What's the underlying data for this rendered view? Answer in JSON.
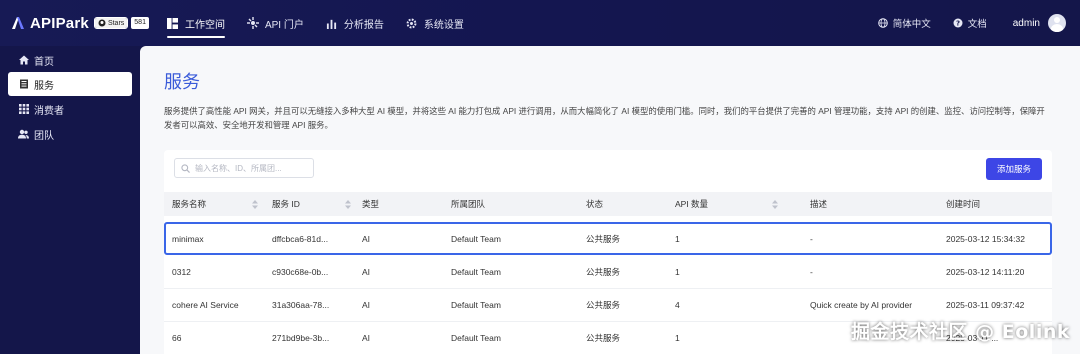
{
  "app": {
    "name": "APIPark",
    "badge_label": "Stars",
    "badge_count": "581"
  },
  "nav": [
    {
      "label": "工作空间",
      "icon": "workspace-icon"
    },
    {
      "label": "API 门户",
      "icon": "portal-icon"
    },
    {
      "label": "分析报告",
      "icon": "chart-icon"
    },
    {
      "label": "系统设置",
      "icon": "gear-icon"
    }
  ],
  "topright": {
    "language": "简体中文",
    "docs": "文档",
    "user": "admin"
  },
  "sidebar": [
    {
      "label": "首页",
      "icon": "home-icon"
    },
    {
      "label": "服务",
      "icon": "service-icon"
    },
    {
      "label": "消费者",
      "icon": "grid-icon"
    },
    {
      "label": "团队",
      "icon": "team-icon"
    }
  ],
  "page": {
    "title": "服务",
    "description": "服务提供了高性能 API 网关，并且可以无缝接入多种大型 AI 模型，并将这些 AI 能力打包成 API 进行调用，从而大幅简化了 AI 模型的使用门槛。同时，我们的平台提供了完善的 API 管理功能，支持 API 的创建、监控、访问控制等，保障开发者可以高效、安全地开发和管理 API 服务。"
  },
  "search": {
    "placeholder": "输入名称、ID、所属团..."
  },
  "add_button": "添加服务",
  "table": {
    "columns": [
      "服务名称",
      "服务 ID",
      "类型",
      "所属团队",
      "状态",
      "API 数量",
      "描述",
      "创建时间"
    ],
    "rows": [
      {
        "name": "minimax",
        "id": "dffcbca6-81d...",
        "type": "AI",
        "team": "Default Team",
        "status": "公共服务",
        "api_count": "1",
        "desc": "-",
        "created": "2025-03-12 15:34:32"
      },
      {
        "name": "0312",
        "id": "c930c68e-0b...",
        "type": "AI",
        "team": "Default Team",
        "status": "公共服务",
        "api_count": "1",
        "desc": "-",
        "created": "2025-03-12 14:11:20"
      },
      {
        "name": "cohere AI Service",
        "id": "31a306aa-78...",
        "type": "AI",
        "team": "Default Team",
        "status": "公共服务",
        "api_count": "4",
        "desc": "Quick create by AI provider",
        "created": "2025-03-11 09:37:42"
      },
      {
        "name": "66",
        "id": "271bd9be-3b...",
        "type": "AI",
        "team": "Default Team",
        "status": "公共服务",
        "api_count": "1",
        "desc": "",
        "created": "2025-03-11 ..."
      }
    ]
  },
  "watermark": "掘金技术社区 @ Eolink"
}
